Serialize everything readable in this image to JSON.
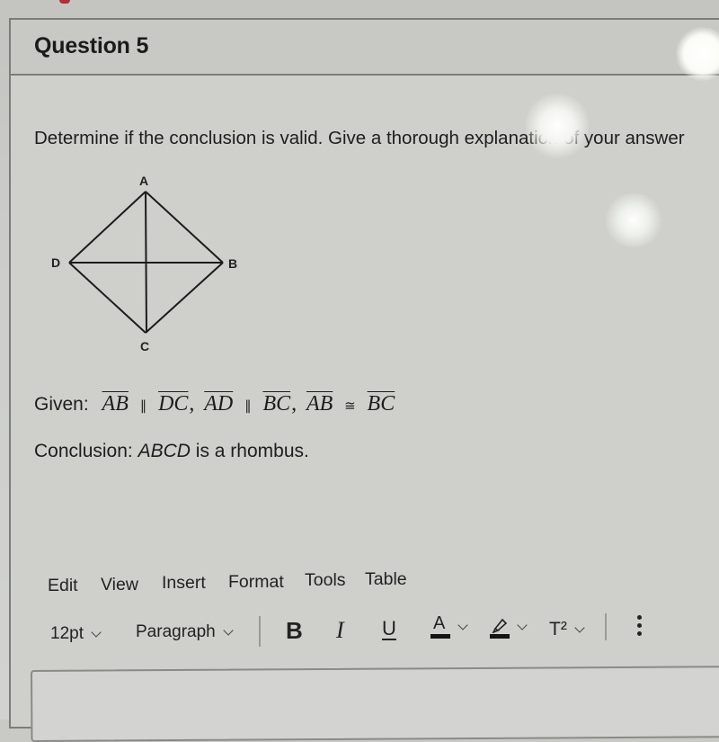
{
  "question": {
    "title": "Question 5",
    "prompt": "Determine if the conclusion is valid. Give a thorough explanation of your answer",
    "figure": {
      "vertices": {
        "top": "A",
        "right": "B",
        "bottom": "C",
        "left": "D"
      }
    },
    "given": {
      "label": "Given:",
      "segments": [
        "AB",
        "DC",
        "AD",
        "BC",
        "AB",
        "BC"
      ],
      "relations": [
        "∥",
        "∥",
        "≅"
      ]
    },
    "conclusion": {
      "label": "Conclusion:",
      "subject": "ABCD",
      "text": "is a rhombus."
    }
  },
  "editor": {
    "menu": [
      "Edit",
      "View",
      "Insert",
      "Format",
      "Tools",
      "Table"
    ],
    "toolbar": {
      "font_size": "12pt",
      "block_format": "Paragraph",
      "bold": "B",
      "italic": "I",
      "underline": "U",
      "text_color": "A",
      "highlight_icon": "highlighter-icon",
      "superscript": "T²",
      "more_icon": "more-vertical-icon"
    },
    "answer_value": ""
  },
  "colors": {
    "text": "#1e1e1e",
    "border": "#7c7d7a",
    "swatch": "#141414"
  }
}
